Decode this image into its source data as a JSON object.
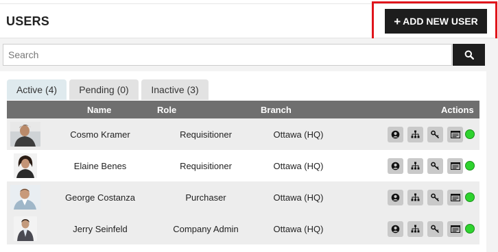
{
  "header": {
    "title": "USERS",
    "add_button_label": "ADD NEW USER",
    "accent_color": "#e0141b"
  },
  "search": {
    "placeholder": "Search",
    "value": ""
  },
  "tabs": [
    {
      "label": "Active (4)",
      "selected": true
    },
    {
      "label": "Pending (0)",
      "selected": false
    },
    {
      "label": "Inactive (3)",
      "selected": false
    }
  ],
  "table": {
    "columns": {
      "name": "Name",
      "role": "Role",
      "branch": "Branch",
      "actions": "Actions"
    },
    "rows": [
      {
        "name": "Cosmo Kramer",
        "role": "Requisitioner",
        "branch": "Ottawa (HQ)",
        "status_color": "#2fd32f"
      },
      {
        "name": "Elaine Benes",
        "role": "Requisitioner",
        "branch": "Ottawa (HQ)",
        "status_color": "#2fd32f"
      },
      {
        "name": "George Costanza",
        "role": "Purchaser",
        "branch": "Ottawa (HQ)",
        "status_color": "#2fd32f"
      },
      {
        "name": "Jerry Seinfeld",
        "role": "Company Admin",
        "branch": "Ottawa (HQ)",
        "status_color": "#2fd32f"
      }
    ],
    "action_icons": [
      "user-profile-icon",
      "hierarchy-icon",
      "key-icon",
      "id-card-icon"
    ]
  }
}
